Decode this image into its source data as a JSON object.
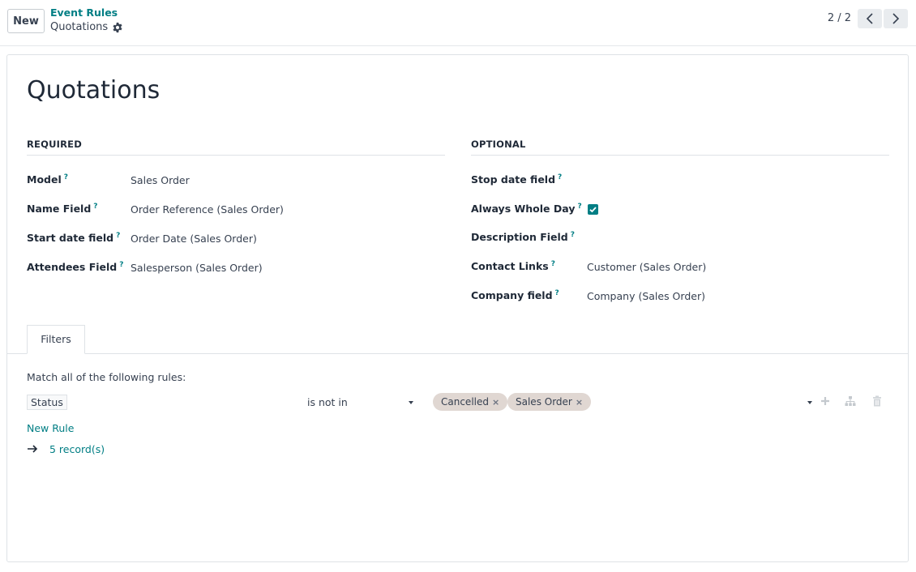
{
  "control_panel": {
    "new_button": "New",
    "breadcrumb_parent": "Event Rules",
    "breadcrumb_current": "Quotations",
    "pager_value": "2 / 2"
  },
  "form": {
    "title": "Quotations",
    "required": {
      "heading": "REQUIRED",
      "fields": [
        {
          "label": "Model",
          "help": "?",
          "value": "Sales Order"
        },
        {
          "label": "Name Field",
          "help": "?",
          "value": "Order Reference (Sales Order)"
        },
        {
          "label": "Start date field",
          "help": "?",
          "value": "Order Date (Sales Order)"
        },
        {
          "label": "Attendees Field",
          "help": "?",
          "value": "Salesperson (Sales Order)"
        }
      ]
    },
    "optional": {
      "heading": "OPTIONAL",
      "fields": [
        {
          "label": "Stop date field",
          "help": "?",
          "value": ""
        },
        {
          "label": "Always Whole Day",
          "help": "?",
          "checked": true
        },
        {
          "label": "Description Field",
          "help": "?",
          "value": ""
        },
        {
          "label": "Contact Links",
          "help": "?",
          "value": "Customer (Sales Order)"
        },
        {
          "label": "Company field",
          "help": "?",
          "value": "Company (Sales Order)"
        }
      ]
    }
  },
  "notebook": {
    "tabs": [
      {
        "label": "Filters",
        "active": true
      }
    ]
  },
  "filters": {
    "match_text": "Match all of the following rules:",
    "rule": {
      "field": "Status",
      "operator": "is not in",
      "values": [
        {
          "label": "Cancelled",
          "remove": "×"
        },
        {
          "label": "Sales Order",
          "remove": "×"
        }
      ]
    },
    "new_rule": "New Rule",
    "records": "5 record(s)"
  },
  "colors": {
    "accent": "#017e84",
    "tag_bg": "#e0d7d2"
  },
  "icons": {
    "gear": "gear-icon",
    "prev": "chevron-left-icon",
    "next": "chevron-right-icon",
    "add": "plus-icon",
    "branch": "sitemap-icon",
    "delete": "trash-icon",
    "arrow": "arrow-right-icon"
  }
}
